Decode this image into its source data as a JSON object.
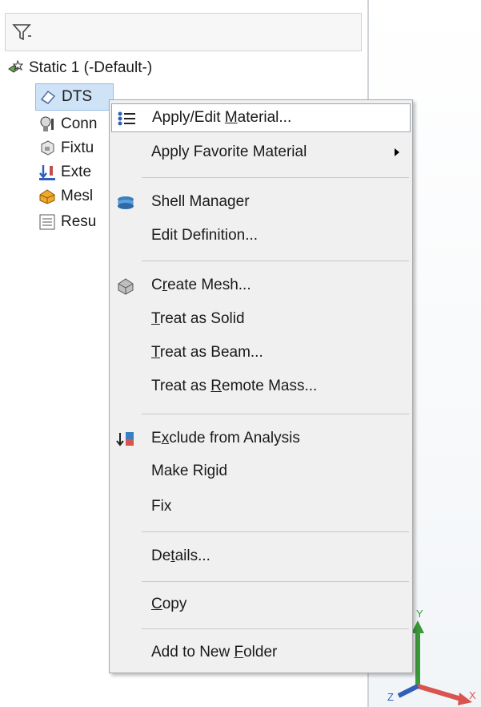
{
  "tree": {
    "root_label": "Static 1 (-Default-)",
    "items": [
      {
        "label": "DTS",
        "icon": "part-icon"
      },
      {
        "label": "Conn",
        "icon": "connections-icon"
      },
      {
        "label": "Fixtu",
        "icon": "fixtures-icon"
      },
      {
        "label": "Exte",
        "icon": "external-loads-icon"
      },
      {
        "label": "Mesl",
        "icon": "mesh-icon"
      },
      {
        "label": "Resu",
        "icon": "results-icon"
      }
    ]
  },
  "context_menu": {
    "items": [
      {
        "pre": "Apply/Edit ",
        "u": "M",
        "post": "aterial...",
        "icon": "material-list-icon"
      },
      {
        "pre": "Apply Favorite Material",
        "u": "",
        "post": "",
        "icon": "none"
      },
      {
        "pre": "Shell Manager",
        "u": "",
        "post": "",
        "icon": "shell-manager-icon"
      },
      {
        "pre": "Edit Definition...",
        "u": "",
        "post": "",
        "icon": "none"
      },
      {
        "pre": "C",
        "u": "r",
        "post": "eate Mesh...",
        "icon": "create-mesh-icon"
      },
      {
        "pre": "",
        "u": "T",
        "post": "reat as Solid",
        "icon": "none"
      },
      {
        "pre": "",
        "u": "T",
        "post": "reat as Beam...",
        "icon": "none"
      },
      {
        "pre": "Treat as ",
        "u": "R",
        "post": "emote Mass...",
        "icon": "none"
      },
      {
        "pre": "E",
        "u": "x",
        "post": "clude from Analysis",
        "icon": "exclude-icon"
      },
      {
        "pre": "Make Rigid",
        "u": "",
        "post": "",
        "icon": "none"
      },
      {
        "pre": "Fix",
        "u": "",
        "post": "",
        "icon": "none"
      },
      {
        "pre": "De",
        "u": "t",
        "post": "ails...",
        "icon": "none"
      },
      {
        "pre": "",
        "u": "C",
        "post": "opy",
        "icon": "none"
      },
      {
        "pre": "Add to New ",
        "u": "F",
        "post": "older",
        "icon": "none"
      }
    ]
  },
  "triad": {
    "x": "X",
    "y": "Y",
    "z": "Z"
  },
  "colors": {
    "selection": "#cfe3f7",
    "menu_bg": "#f0f0f0",
    "x_axis": "#d9534f",
    "y_axis": "#3a9a3a",
    "z_axis": "#2f5fb8"
  }
}
